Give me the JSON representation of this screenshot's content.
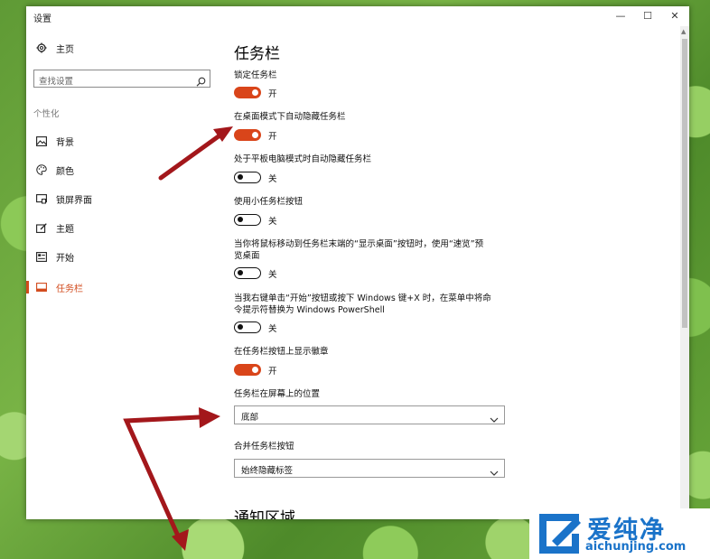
{
  "window": {
    "title": "设置",
    "controls": {
      "minimize": "—",
      "maximize": "☐",
      "close": "✕"
    }
  },
  "sidebar": {
    "home_label": "主页",
    "search_placeholder": "查找设置",
    "section_label": "个性化",
    "items": [
      {
        "label": "背景",
        "icon": "picture-icon"
      },
      {
        "label": "颜色",
        "icon": "palette-icon"
      },
      {
        "label": "锁屏界面",
        "icon": "lockscreen-icon"
      },
      {
        "label": "主题",
        "icon": "theme-brush-icon"
      },
      {
        "label": "开始",
        "icon": "start-grid-icon"
      },
      {
        "label": "任务栏",
        "icon": "taskbar-icon",
        "active": true
      }
    ]
  },
  "main": {
    "title": "任务栏",
    "settings": [
      {
        "label": "锁定任务栏",
        "state": "开",
        "on": true
      },
      {
        "label": "在桌面模式下自动隐藏任务栏",
        "state": "开",
        "on": true
      },
      {
        "label": "处于平板电脑模式时自动隐藏任务栏",
        "state": "关",
        "on": false
      },
      {
        "label": "使用小任务栏按钮",
        "state": "关",
        "on": false
      },
      {
        "label_line1": "当你将鼠标移动到任务栏末端的“显示桌面”按钮时，使用“速览”预",
        "label_line2": "览桌面",
        "state": "关",
        "on": false
      },
      {
        "label_line1": "当我右键单击“开始”按钮或按下 Windows 键+X 时，在菜单中将命",
        "label_line2": "令提示符替换为 Windows PowerShell",
        "state": "关",
        "on": false
      },
      {
        "label": "在任务栏按钮上显示徽章",
        "state": "开",
        "on": true
      }
    ],
    "position": {
      "label": "任务栏在屏幕上的位置",
      "value": "底部"
    },
    "combine": {
      "label": "合并任务栏按钮",
      "value": "始终隐藏标签"
    },
    "notify_title": "通知区域"
  },
  "watermark": {
    "title": "爱纯净",
    "url": "aichunjing.com"
  },
  "colors": {
    "accent": "#d9451a",
    "arrow": "#a3171b",
    "watermark": "#1a73c9"
  }
}
